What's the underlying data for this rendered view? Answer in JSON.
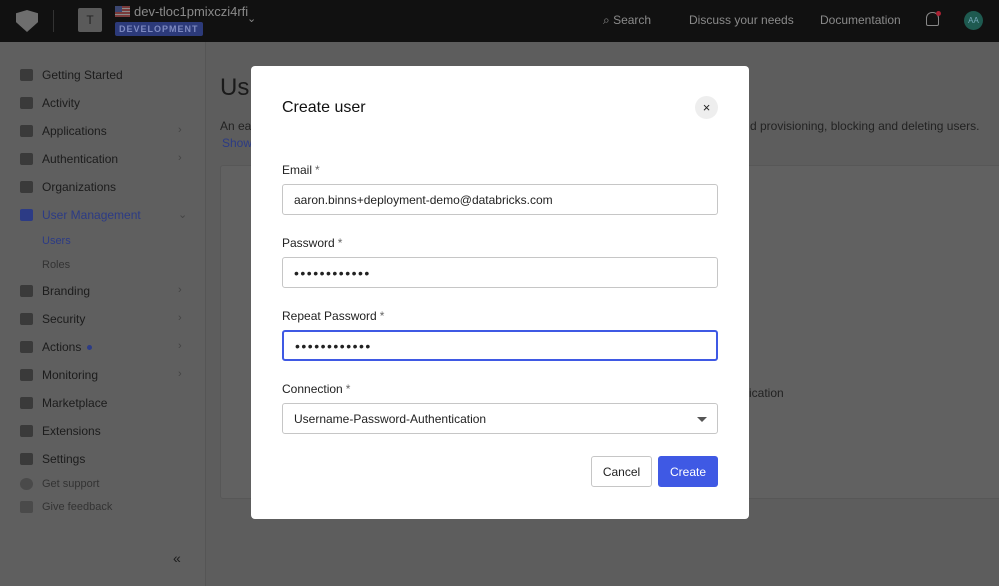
{
  "topbar": {
    "tenant_initial": "T",
    "tenant": "dev-tloc1pmixczi4rfi",
    "environment": "DEVELOPMENT",
    "search": "Search",
    "discuss": "Discuss your needs",
    "docs": "Documentation",
    "avatar": "AA"
  },
  "sidebar": {
    "items": [
      {
        "label": "Getting Started"
      },
      {
        "label": "Activity"
      },
      {
        "label": "Applications"
      },
      {
        "label": "Authentication"
      },
      {
        "label": "Organizations"
      },
      {
        "label": "User Management"
      },
      {
        "label": "Users"
      },
      {
        "label": "Roles"
      },
      {
        "label": "Branding"
      },
      {
        "label": "Security"
      },
      {
        "label": "Actions"
      },
      {
        "label": "Monitoring"
      },
      {
        "label": "Marketplace"
      },
      {
        "label": "Extensions"
      },
      {
        "label": "Settings"
      },
      {
        "label": "Get support"
      },
      {
        "label": "Give feedback"
      }
    ],
    "collapse": "«"
  },
  "background": {
    "title_fragment": "Us",
    "desc_left": "An eas",
    "desc_right": "d provisioning, blocking and deleting users.",
    "show": "Show",
    "card_fragment": "ication"
  },
  "modal": {
    "title": "Create user",
    "close": "×",
    "email_label": "Email",
    "email_value": "aaron.binns+deployment-demo@databricks.com",
    "password_label": "Password",
    "password_value": "••••••••••••",
    "repeat_label": "Repeat Password",
    "repeat_value": "••••••••••••",
    "connection_label": "Connection",
    "connection_value": "Username-Password-Authentication",
    "required": "*",
    "cancel": "Cancel",
    "create": "Create"
  },
  "colors": {
    "primary": "#3f59e4",
    "overlay": "rgba(0,0,0,0.6)"
  }
}
